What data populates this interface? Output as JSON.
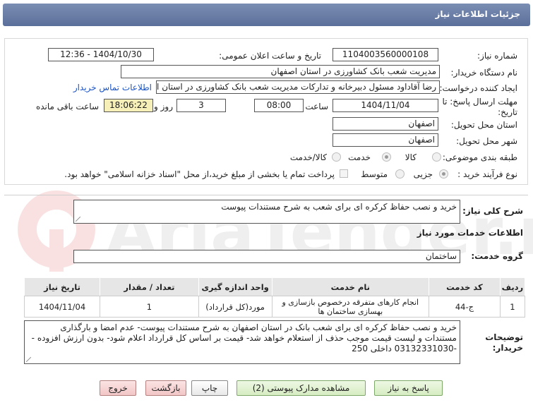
{
  "header": {
    "title": "جزئیات اطلاعات نیاز"
  },
  "form": {
    "need_number_label": "شماره نیاز:",
    "need_number": "1104003560000108",
    "announce_label": "تاریخ و ساعت اعلان عمومی:",
    "announce_value": "1404/10/30 - 12:36",
    "buyer_org_label": "نام دستگاه خریدار:",
    "buyer_org": "مدیریت شعب بانک کشاورزی در استان اصفهان",
    "creator_label": "ایجاد کننده درخواست:",
    "creator": "رضا آقاداود مسئول دبیرخانه و تدارکات مدیریت شعب بانک کشاورزی در استان اص",
    "contact_link": "اطلاعات تماس خریدار",
    "deadline_label": "مهلت ارسال پاسخ: تا تاریخ:",
    "deadline_date": "1404/11/04",
    "time_label": "ساعت",
    "deadline_time": "08:00",
    "days_value": "3",
    "days_label": "روز و",
    "remaining_time": "18:06:22",
    "remaining_label": "ساعت باقی مانده",
    "province_label": "استان محل تحویل:",
    "province": "اصفهان",
    "city_label": "شهر محل تحویل:",
    "city": "اصفهان",
    "category_label": "طبقه بندی موضوعی:",
    "category_options": [
      "کالا",
      "خدمت",
      "کالا/خدمت"
    ],
    "category_selected": "خدمت",
    "process_label": "نوع فرآیند خرید :",
    "process_options": [
      "جزیی",
      "متوسط"
    ],
    "process_selected": "جزیی",
    "payment_note": "پرداخت تمام یا بخشی از مبلغ خرید،از محل \"اسناد خزانه اسلامی\" خواهد بود."
  },
  "summary": {
    "label": "شرح کلی نیاز:",
    "value": "خرید و نصب حفاظ کرکره ای برای شعب به شرح مستندات پیوست"
  },
  "services": {
    "section_title": "اطلاعات خدمات مورد نیاز",
    "group_label": "گروه خدمت:",
    "group_value": "ساختمان",
    "columns": [
      "ردیف",
      "کد خدمت",
      "نام خدمت",
      "واحد اندازه گیری",
      "تعداد / مقدار",
      "تاریخ نیاز"
    ],
    "rows": [
      [
        "1",
        "ج-44",
        "انجام کارهای متفرقه درخصوص بازسازی و بهسازی ساختمان ها",
        "مورد(کل قرارداد)",
        "1",
        "1404/11/04"
      ]
    ]
  },
  "buyer_notes": {
    "label": "توضیحات خریدار:",
    "value": "خرید و نصب حفاظ کرکره ای برای شعب بانک در استان اصفهان  به شرح مستندات پیوست- عدم امضا و بارگذاری مستندات و لیست قیمت موجب حذف از استعلام خواهد شد- قیمت بر اساس کل قرارداد اعلام شود- بدون ارزش افزوده --03132331030 داخلی 250"
  },
  "buttons": {
    "reply": "پاسخ به نیاز",
    "attachments": "مشاهده مدارک پیوستی (2)",
    "print": "چاپ",
    "back": "بازگشت",
    "exit": "خروج"
  },
  "watermark": {
    "text": "AriaTender.net"
  },
  "colors": {
    "header": "#6a7fa8",
    "link": "#1a54c4",
    "highlight": "#f6efb8"
  }
}
